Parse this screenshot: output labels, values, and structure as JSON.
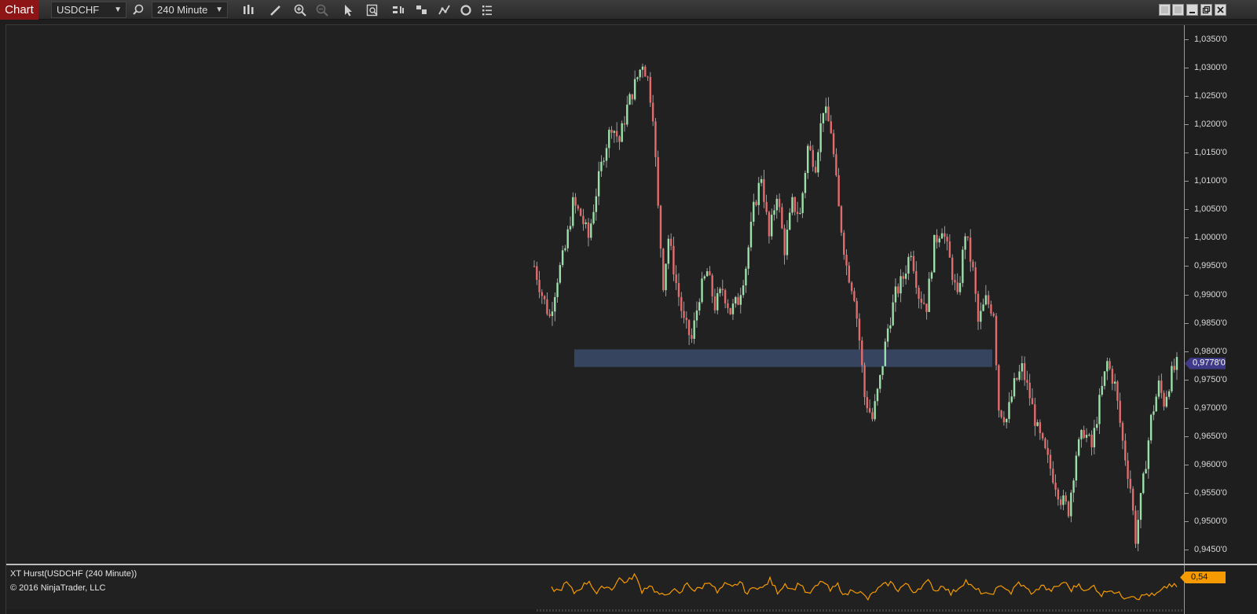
{
  "toolbar": {
    "chart_tab": "Chart",
    "instrument": "USDCHF",
    "timeframe": "240 Minute",
    "icons": [
      "search-icon",
      "bar-type-icon",
      "draw-pencil-icon",
      "zoom-in-icon",
      "zoom-out-icon",
      "pointer-icon",
      "properties-icon",
      "strategies-icon",
      "indicators-icon",
      "chart-trader-icon",
      "reload-icon",
      "data-box-icon"
    ],
    "window_buttons": [
      "restore-icon",
      "tile-icon",
      "minimize-icon",
      "maximize-icon",
      "close-icon"
    ]
  },
  "price_axis": {
    "labels": [
      "1,0350'0",
      "1,0300'0",
      "1,0250'0",
      "1,0200'0",
      "1,0150'0",
      "1,0100'0",
      "1,0050'0",
      "1,0000'0",
      "0,9950'0",
      "0,9900'0",
      "0,9850'0",
      "0,9800'0",
      "0,9750'0",
      "0,9700'0",
      "0,9650'0",
      "0,9600'0",
      "0,9550'0",
      "0,9500'0",
      "0,9450'0"
    ],
    "current_price": "0,9778'0"
  },
  "indicator": {
    "title": "XT Hurst(USDCHF (240 Minute))",
    "copyright": "© 2016 NinjaTrader, LLC",
    "value": "0,54"
  },
  "colors": {
    "up_candle": "#9be0a8",
    "down_candle": "#e26b6b",
    "zone": "#3a4a6b",
    "indicator_line": "#f59a00",
    "price_tag": "#3f3a88"
  },
  "chart_data": {
    "type": "candlestick",
    "instrument": "USDCHF",
    "ylim": [
      0.9425,
      1.0375
    ],
    "current_price": 0.9778,
    "zone": {
      "low": 0.9772,
      "high": 0.9803
    },
    "close_path": [
      [
        0,
        0.995
      ],
      [
        3,
        0.99
      ],
      [
        6,
        0.986
      ],
      [
        9,
        0.993
      ],
      [
        12,
        0.998
      ],
      [
        15,
        1.006
      ],
      [
        18,
        1.004
      ],
      [
        21,
        1.0
      ],
      [
        24,
        1.008
      ],
      [
        27,
        1.015
      ],
      [
        30,
        1.02
      ],
      [
        33,
        1.017
      ],
      [
        36,
        1.023
      ],
      [
        39,
        1.027
      ],
      [
        42,
        1.031
      ],
      [
        44,
        1.028
      ],
      [
        46,
        1.022
      ],
      [
        48,
        1.005
      ],
      [
        50,
        0.992
      ],
      [
        52,
        1.0
      ],
      [
        55,
        0.992
      ],
      [
        58,
        0.985
      ],
      [
        61,
        0.982
      ],
      [
        64,
        0.99
      ],
      [
        67,
        0.994
      ],
      [
        70,
        0.988
      ],
      [
        73,
        0.991
      ],
      [
        76,
        0.987
      ],
      [
        79,
        0.989
      ],
      [
        82,
        0.995
      ],
      [
        85,
        1.005
      ],
      [
        88,
        1.011
      ],
      [
        91,
        1.0
      ],
      [
        94,
        1.008
      ],
      [
        97,
        0.998
      ],
      [
        100,
        1.006
      ],
      [
        103,
        1.004
      ],
      [
        106,
        1.016
      ],
      [
        109,
        1.013
      ],
      [
        112,
        1.023
      ],
      [
        115,
        1.019
      ],
      [
        118,
        1.005
      ],
      [
        121,
        0.995
      ],
      [
        124,
        0.99
      ],
      [
        126,
        0.982
      ],
      [
        128,
        0.972
      ],
      [
        131,
        0.968
      ],
      [
        134,
        0.975
      ],
      [
        137,
        0.984
      ],
      [
        140,
        0.99
      ],
      [
        143,
        0.993
      ],
      [
        146,
        0.998
      ],
      [
        149,
        0.99
      ],
      [
        152,
        0.988
      ],
      [
        155,
        0.999
      ],
      [
        158,
        1.002
      ],
      [
        161,
        0.996
      ],
      [
        164,
        0.989
      ],
      [
        167,
        1.001
      ],
      [
        170,
        0.994
      ],
      [
        172,
        0.985
      ],
      [
        175,
        0.989
      ],
      [
        178,
        0.987
      ],
      [
        180,
        0.97
      ],
      [
        183,
        0.968
      ],
      [
        186,
        0.974
      ],
      [
        189,
        0.977
      ],
      [
        192,
        0.972
      ],
      [
        195,
        0.966
      ],
      [
        198,
        0.962
      ],
      [
        201,
        0.958
      ],
      [
        204,
        0.954
      ],
      [
        207,
        0.952
      ],
      [
        210,
        0.962
      ],
      [
        213,
        0.966
      ],
      [
        216,
        0.963
      ],
      [
        219,
        0.971
      ],
      [
        222,
        0.978
      ],
      [
        225,
        0.974
      ],
      [
        228,
        0.964
      ],
      [
        231,
        0.956
      ],
      [
        233,
        0.947
      ],
      [
        236,
        0.957
      ],
      [
        239,
        0.968
      ],
      [
        242,
        0.974
      ],
      [
        244,
        0.971
      ],
      [
        247,
        0.976
      ],
      [
        249,
        0.9775
      ]
    ],
    "hurst_path": [
      [
        0,
        0.52
      ],
      [
        3,
        0.5
      ],
      [
        6,
        0.58
      ],
      [
        9,
        0.48
      ],
      [
        12,
        0.54
      ],
      [
        15,
        0.6
      ],
      [
        18,
        0.47
      ],
      [
        21,
        0.55
      ],
      [
        24,
        0.52
      ],
      [
        27,
        0.62
      ],
      [
        30,
        0.58
      ],
      [
        33,
        0.66
      ],
      [
        36,
        0.5
      ],
      [
        39,
        0.56
      ],
      [
        42,
        0.48
      ],
      [
        45,
        0.44
      ],
      [
        48,
        0.52
      ],
      [
        51,
        0.46
      ],
      [
        54,
        0.58
      ],
      [
        57,
        0.5
      ],
      [
        60,
        0.54
      ],
      [
        63,
        0.6
      ],
      [
        66,
        0.48
      ],
      [
        69,
        0.56
      ],
      [
        72,
        0.53
      ],
      [
        75,
        0.59
      ],
      [
        78,
        0.47
      ],
      [
        81,
        0.55
      ],
      [
        84,
        0.52
      ],
      [
        87,
        0.61
      ],
      [
        90,
        0.49
      ],
      [
        93,
        0.57
      ],
      [
        96,
        0.51
      ],
      [
        99,
        0.58
      ],
      [
        102,
        0.46
      ],
      [
        105,
        0.53
      ],
      [
        108,
        0.6
      ],
      [
        111,
        0.5
      ],
      [
        114,
        0.56
      ],
      [
        117,
        0.45
      ],
      [
        120,
        0.52
      ],
      [
        123,
        0.48
      ],
      [
        126,
        0.42
      ],
      [
        129,
        0.5
      ],
      [
        132,
        0.55
      ],
      [
        135,
        0.58
      ],
      [
        138,
        0.51
      ],
      [
        141,
        0.57
      ],
      [
        144,
        0.49
      ],
      [
        147,
        0.54
      ],
      [
        150,
        0.59
      ],
      [
        153,
        0.5
      ],
      [
        156,
        0.56
      ],
      [
        159,
        0.47
      ],
      [
        162,
        0.53
      ],
      [
        165,
        0.6
      ],
      [
        168,
        0.52
      ],
      [
        171,
        0.49
      ],
      [
        174,
        0.45
      ],
      [
        177,
        0.51
      ],
      [
        180,
        0.55
      ],
      [
        183,
        0.48
      ],
      [
        186,
        0.58
      ],
      [
        189,
        0.52
      ],
      [
        192,
        0.47
      ],
      [
        195,
        0.56
      ],
      [
        198,
        0.5
      ],
      [
        201,
        0.53
      ],
      [
        204,
        0.59
      ],
      [
        207,
        0.51
      ],
      [
        210,
        0.57
      ],
      [
        213,
        0.49
      ],
      [
        216,
        0.55
      ],
      [
        219,
        0.46
      ],
      [
        222,
        0.52
      ],
      [
        225,
        0.48
      ],
      [
        228,
        0.44
      ],
      [
        231,
        0.46
      ],
      [
        234,
        0.43
      ],
      [
        237,
        0.47
      ],
      [
        240,
        0.45
      ],
      [
        243,
        0.5
      ],
      [
        246,
        0.56
      ],
      [
        249,
        0.54
      ]
    ]
  }
}
